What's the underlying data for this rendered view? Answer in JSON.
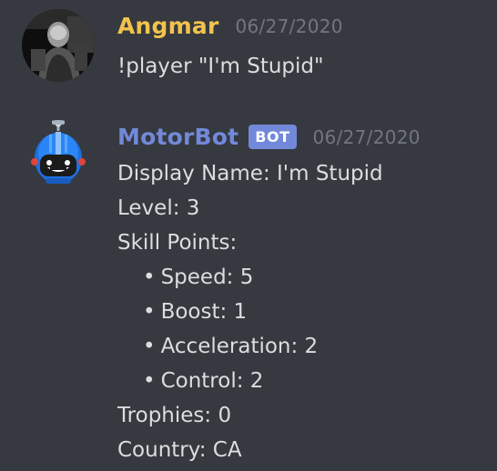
{
  "messages": [
    {
      "author": "Angmar",
      "author_color": "#f1c34d",
      "timestamp": "06/27/2020",
      "text": "!player \"I'm Stupid\""
    },
    {
      "author": "MotorBot",
      "author_color": "#7289da",
      "bot_tag": "BOT",
      "timestamp": "06/27/2020",
      "lines": {
        "display_name": "Display Name: I'm Stupid",
        "level": "Level: 3",
        "skill_points": "Skill Points:",
        "speed": "Speed: 5",
        "boost": "Boost: 1",
        "acceleration": "Acceleration: 2",
        "control": "Control: 2",
        "trophies": "Trophies: 0",
        "country": "Country: CA"
      },
      "bullet": "•"
    }
  ]
}
